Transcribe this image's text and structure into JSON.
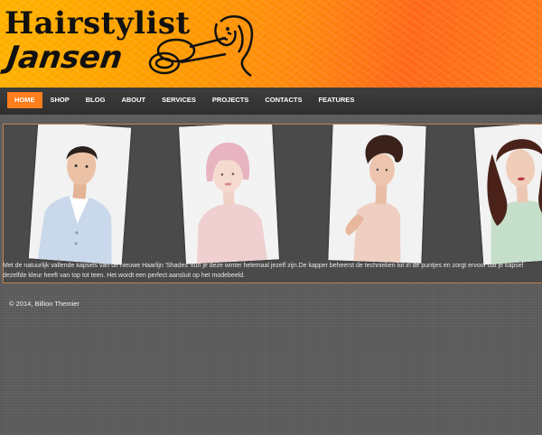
{
  "header": {
    "logo_line1": "Hairstylist",
    "logo_line2": "Jansen",
    "logo_art_icon": "scissors-stylist-icon",
    "brand_color": "#ff9000"
  },
  "nav": {
    "items": [
      {
        "label": "HOME",
        "active": true
      },
      {
        "label": "SHOP"
      },
      {
        "label": "BLOG"
      },
      {
        "label": "ABOUT"
      },
      {
        "label": "SERVICES"
      },
      {
        "label": "PROJECTS"
      },
      {
        "label": "CONTACTS"
      },
      {
        "label": "FEATURES"
      }
    ],
    "active_color": "#ff7e1d"
  },
  "slider": {
    "photos": [
      {
        "subject": "man-light-blue-cardigan"
      },
      {
        "subject": "woman-pink-bob"
      },
      {
        "subject": "woman-updo-blush-dress"
      },
      {
        "subject": "woman-curls-mint-jacket"
      }
    ],
    "caption": "Met de natuurlijk vallende kapsels van de nieuwe Haarlijn 'Shades' kun je deze winter helemaal jezelf zijn.De kapper beheerst de technieken tot in de puntjes en zorgt ervoor dat je kapsel dezelfde kleur heeft van top tot teen. Het wordt een perfect aansluit op het modebeeld."
  },
  "footer": {
    "copyright": "© 2014, Billion Themier"
  }
}
